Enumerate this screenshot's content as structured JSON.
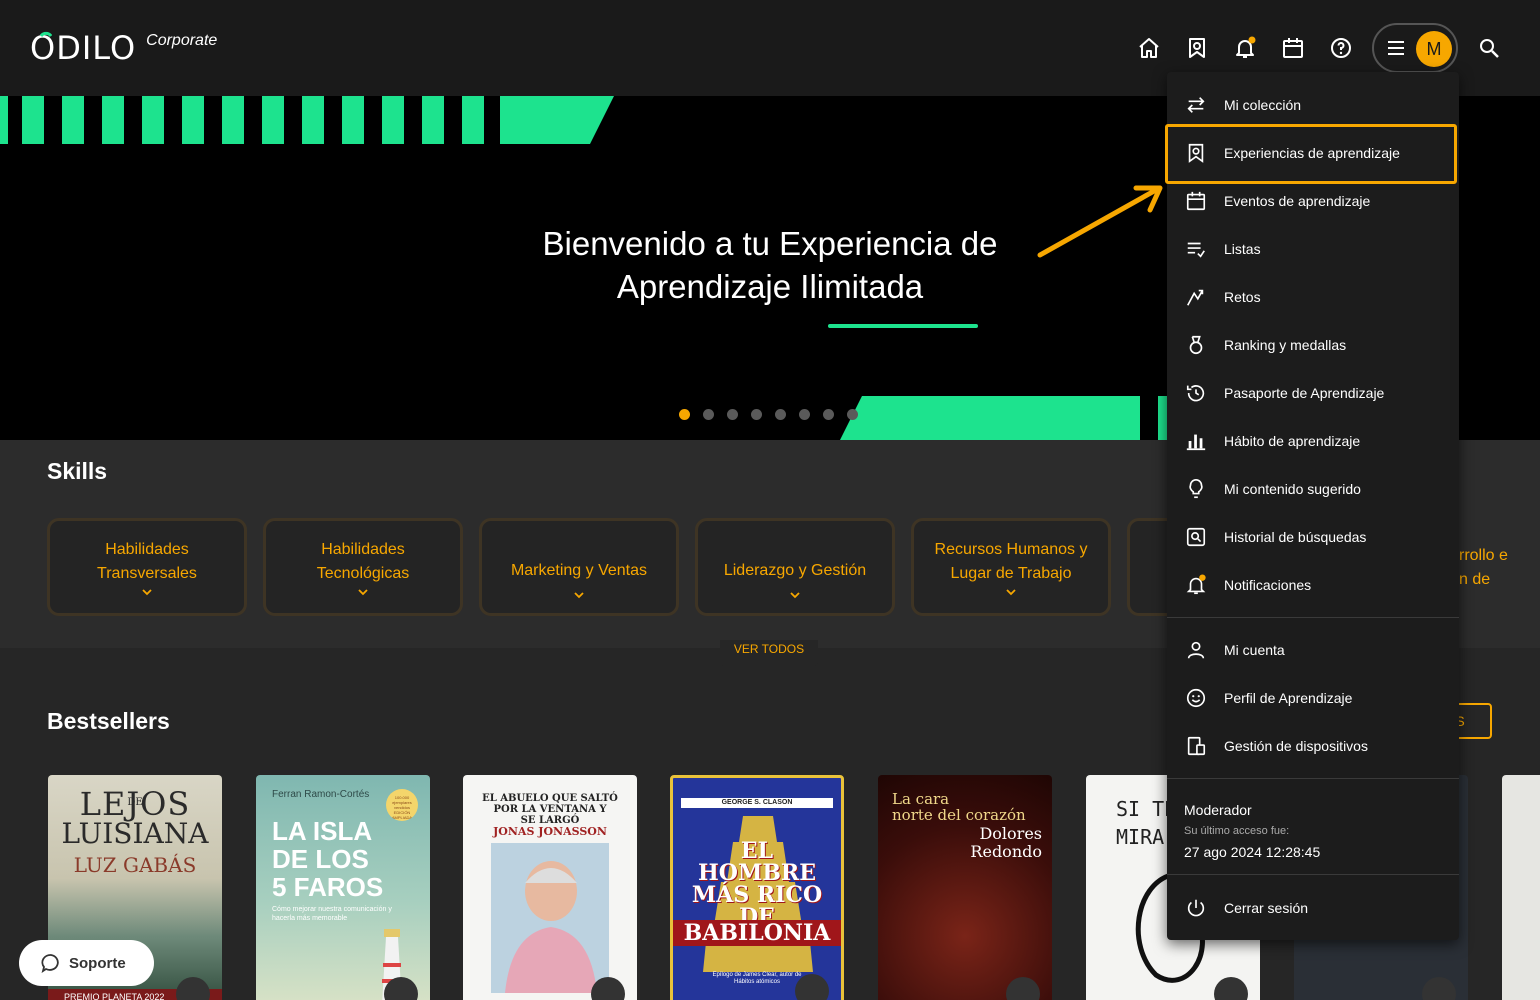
{
  "header": {
    "logo_text": "ODILO",
    "logo_sub": "Corporate",
    "icons": [
      "home-icon",
      "bookmark-icon",
      "bell-icon",
      "calendar-icon",
      "help-icon",
      "hamburger-icon",
      "search-icon"
    ],
    "avatar_initial": "M",
    "colors": {
      "accent": "#f7a700",
      "brand_green": "#1de38e",
      "bg": "#1a1a1a"
    }
  },
  "hero": {
    "title_line1": "Bienvenido a tu Experiencia de",
    "title_line2": "Aprendizaje Ilimitada",
    "slide_count": 8,
    "active_slide": 1
  },
  "skills": {
    "title": "Skills",
    "cards": [
      {
        "line1": "Habilidades",
        "line2": "Transversales"
      },
      {
        "line1": "Habilidades",
        "line2": "Tecnológicas"
      },
      {
        "line1": "Marketing y Ventas",
        "line2": ""
      },
      {
        "line1": "Liderazgo y Gestión",
        "line2": ""
      },
      {
        "line1": "Recursos Humanos y",
        "line2": "Lugar de Trabajo"
      }
    ],
    "partial_right_line1": "rrollo e",
    "partial_right_line2": "n de",
    "ver_todos": "VER TODOS"
  },
  "bestsellers": {
    "title": "Bestsellers",
    "more_button": "ÁS",
    "books": [
      {
        "title1": "LEJOS",
        "title2": "DE",
        "title3": "LUISIANA",
        "author": "LUZ GABÁS",
        "footer": "PREMIO PLANETA 2022"
      },
      {
        "author": "Ferran Ramon-Cortés",
        "title1": "LA ISLA",
        "title2": "DE LOS",
        "title3": "5 FAROS",
        "subtitle": "Cómo mejorar nuestra comunicación y hacerla más memorable",
        "badge": "100.000 ejemplares vendidos EDICIÓN AMPLIADA"
      },
      {
        "title1": "EL ABUELO QUE SALTÓ",
        "title2": "POR LA VENTANA Y",
        "title3": "SE LARGÓ",
        "author": "JONAS JONASSON"
      },
      {
        "author": "GEORGE S. CLASON",
        "title1": "EL",
        "title2": "HOMBRE",
        "title3": "MÁS RICO",
        "title4": "DE",
        "title5": "BABILONIA",
        "footer": "Epílogo de James Clear, autor de Hábitos atómicos"
      },
      {
        "title1": "La cara",
        "title2": "norte del corazón",
        "author1": "Dolores",
        "author2": "Redondo"
      },
      {
        "title1": "SI TE",
        "title2": "MIRA"
      }
    ]
  },
  "menu": {
    "items": [
      {
        "label": "Mi colección",
        "icon": "swap-icon"
      },
      {
        "label": "Experiencias de aprendizaje",
        "icon": "bookmark-icon"
      },
      {
        "label": "Eventos de aprendizaje",
        "icon": "calendar-icon"
      },
      {
        "label": "Listas",
        "icon": "list-icon"
      },
      {
        "label": "Retos",
        "icon": "challenge-icon"
      },
      {
        "label": "Ranking y medallas",
        "icon": "medal-icon"
      },
      {
        "label": "Pasaporte de Aprendizaje",
        "icon": "history-icon"
      },
      {
        "label": "Hábito de aprendizaje",
        "icon": "bar-chart-icon"
      },
      {
        "label": "Mi contenido sugerido",
        "icon": "lightbulb-icon"
      },
      {
        "label": "Historial de búsquedas",
        "icon": "search-history-icon"
      },
      {
        "label": "Notificaciones",
        "icon": "bell-icon"
      }
    ],
    "account_items": [
      {
        "label": "Mi cuenta",
        "icon": "user-icon"
      },
      {
        "label": "Perfil de Aprendizaje",
        "icon": "smiley-icon"
      },
      {
        "label": "Gestión de dispositivos",
        "icon": "devices-icon"
      }
    ],
    "user": {
      "role": "Moderador",
      "last_access_label": "Su último acceso fue:",
      "last_access_value": "27 ago 2024 12:28:45"
    },
    "logout": {
      "label": "Cerrar sesión",
      "icon": "power-icon"
    }
  },
  "support": {
    "label": "Soporte"
  }
}
